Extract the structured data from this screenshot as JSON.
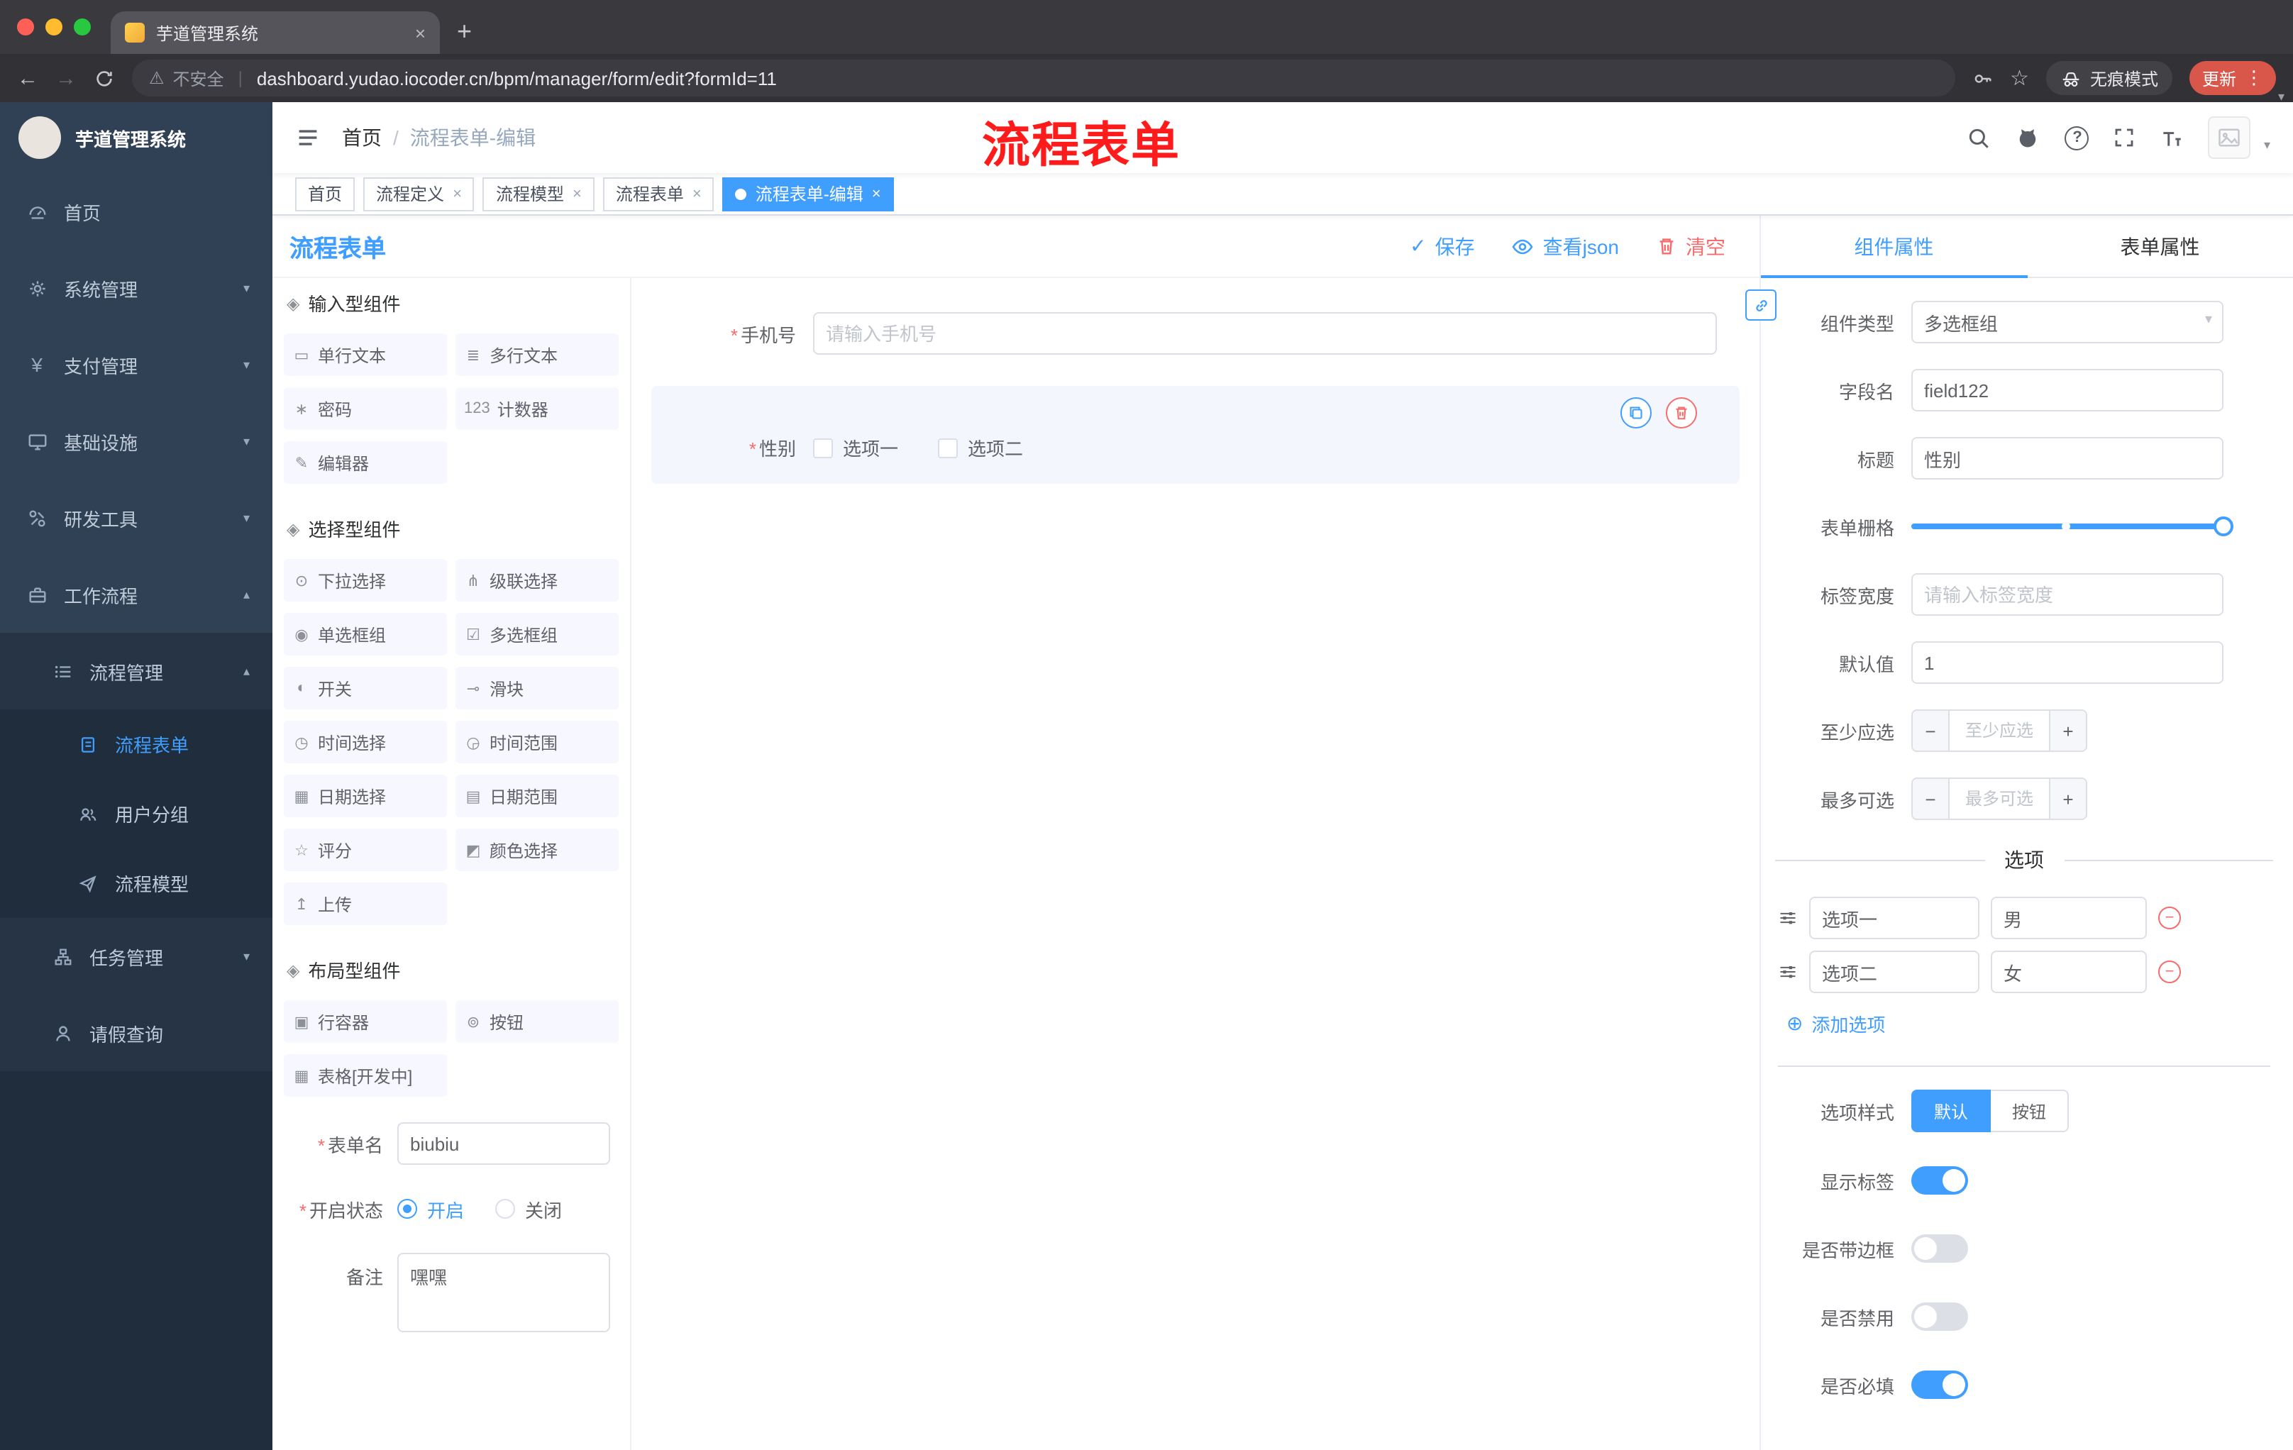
{
  "browser": {
    "tab_title": "芋道管理系统",
    "security": "不安全",
    "url": "dashboard.yudao.iocoder.cn/bpm/manager/form/edit?formId=11",
    "incognito": "无痕模式",
    "update": "更新"
  },
  "sidebar": {
    "title": "芋道管理系统",
    "menu": [
      {
        "label": "首页"
      },
      {
        "label": "系统管理"
      },
      {
        "label": "支付管理"
      },
      {
        "label": "基础设施"
      },
      {
        "label": "研发工具"
      },
      {
        "label": "工作流程"
      }
    ],
    "submenu": {
      "label": "流程管理",
      "children": [
        {
          "label": "流程表单"
        },
        {
          "label": "用户分组"
        },
        {
          "label": "流程模型"
        }
      ]
    },
    "menu2": [
      {
        "label": "任务管理"
      },
      {
        "label": "请假查询"
      }
    ]
  },
  "header": {
    "breadcrumb_home": "首页",
    "breadcrumb_sep": "/",
    "breadcrumb_current": "流程表单-编辑",
    "annotation": "流程表单"
  },
  "tags": [
    {
      "label": "首页"
    },
    {
      "label": "流程定义"
    },
    {
      "label": "流程模型"
    },
    {
      "label": "流程表单"
    },
    {
      "label": "流程表单-编辑"
    }
  ],
  "designer": {
    "title": "流程表单",
    "actions": {
      "save": "保存",
      "view_json": "查看json",
      "clear": "清空"
    },
    "palette": {
      "sections": [
        {
          "title": "输入型组件",
          "items": [
            {
              "icon": "▭",
              "label": "单行文本"
            },
            {
              "icon": "≣",
              "label": "多行文本"
            },
            {
              "icon": "∗",
              "label": "密码"
            },
            {
              "icon": "123",
              "label": "计数器"
            },
            {
              "icon": "✎",
              "label": "编辑器"
            }
          ]
        },
        {
          "title": "选择型组件",
          "items": [
            {
              "icon": "⊙",
              "label": "下拉选择"
            },
            {
              "icon": "⋔",
              "label": "级联选择"
            },
            {
              "icon": "◉",
              "label": "单选框组"
            },
            {
              "icon": "☑",
              "label": "多选框组"
            },
            {
              "icon": "◐",
              "label": "开关"
            },
            {
              "icon": "⊸",
              "label": "滑块"
            },
            {
              "icon": "◷",
              "label": "时间选择"
            },
            {
              "icon": "◶",
              "label": "时间范围"
            },
            {
              "icon": "▦",
              "label": "日期选择"
            },
            {
              "icon": "▤",
              "label": "日期范围"
            },
            {
              "icon": "☆",
              "label": "评分"
            },
            {
              "icon": "◩",
              "label": "颜色选择"
            },
            {
              "icon": "↥",
              "label": "上传"
            }
          ]
        },
        {
          "title": "布局型组件",
          "items": [
            {
              "icon": "▣",
              "label": "行容器"
            },
            {
              "icon": "⊚",
              "label": "按钮"
            },
            {
              "icon": "▦",
              "label": "表格[开发中]"
            }
          ]
        }
      ]
    },
    "meta": {
      "form_name_label": "表单名",
      "form_name_value": "biubiu",
      "status_label": "开启状态",
      "status_on": "开启",
      "status_off": "关闭",
      "remark_label": "备注",
      "remark_value": "嘿嘿"
    },
    "canvas": {
      "phone": {
        "label": "手机号",
        "placeholder": "请输入手机号"
      },
      "gender": {
        "label": "性别",
        "options": [
          "选项一",
          "选项二"
        ]
      }
    }
  },
  "panel": {
    "tabs": [
      {
        "label": "组件属性"
      },
      {
        "label": "表单属性"
      }
    ],
    "fields": {
      "component_type": {
        "label": "组件类型",
        "value": "多选框组"
      },
      "field_name": {
        "label": "字段名",
        "value": "field122"
      },
      "title": {
        "label": "标题",
        "value": "性别"
      },
      "grid": {
        "label": "表单栅格"
      },
      "label_width": {
        "label": "标签宽度",
        "placeholder": "请输入标签宽度"
      },
      "default_value": {
        "label": "默认值",
        "value": "1"
      },
      "min_select": {
        "label": "至少应选",
        "placeholder": "至少应选"
      },
      "max_select": {
        "label": "最多可选",
        "placeholder": "最多可选"
      }
    },
    "options": {
      "divider": "选项",
      "rows": [
        {
          "name": "选项一",
          "value": "男"
        },
        {
          "name": "选项二",
          "value": "女"
        }
      ],
      "add": "添加选项"
    },
    "style": {
      "label": "选项样式",
      "opt_default": "默认",
      "opt_button": "按钮"
    },
    "switches": [
      {
        "label": "显示标签"
      },
      {
        "label": "是否带边框"
      },
      {
        "label": "是否禁用"
      },
      {
        "label": "是否必填"
      }
    ]
  },
  "ui": {
    "asterisk": "*",
    "close": "×",
    "new_tab": "+",
    "back": "←",
    "forward": "→",
    "star": "☆",
    "kebab": "⋮",
    "caret": "▾",
    "warning": "⚠",
    "divider": "|",
    "question": "?",
    "check": "✓",
    "minus": "−",
    "plus": "+",
    "add_icon": "⊕",
    "yen": "¥",
    "arrow_down": "▾",
    "arrow_up": "▴",
    "section_icon": "◈"
  },
  "colors": {
    "accent": "#409EFF",
    "danger": "#F56C6C"
  }
}
